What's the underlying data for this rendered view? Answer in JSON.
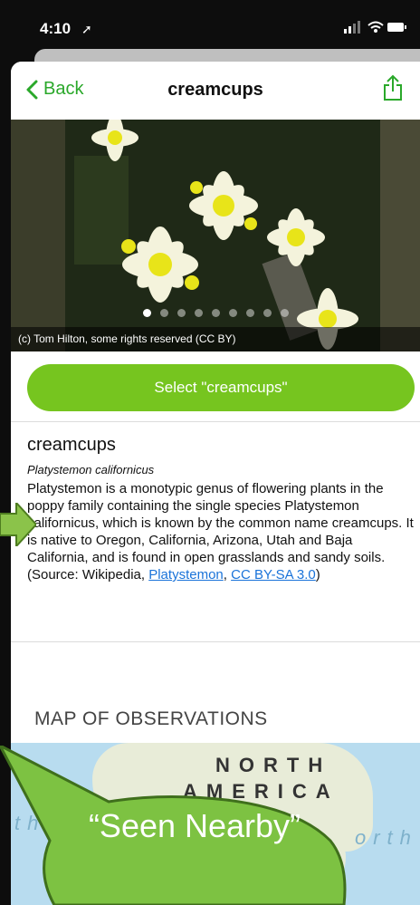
{
  "status_bar": {
    "time": "4:10"
  },
  "nav": {
    "back_label": "Back",
    "title": "creamcups"
  },
  "photo": {
    "credit": "(c) Tom Hilton, some rights reserved (CC BY)",
    "dot_count": 9,
    "active_dot": 0
  },
  "select_button": {
    "label": "Select \"creamcups\""
  },
  "species": {
    "common_name": "creamcups",
    "scientific_name": "Platystemon californicus",
    "description": "Platystemon is a monotypic genus of flowering plants in the poppy family containing the single species Platystemon californicus, which is known by the common name creamcups. It is native to Oregon, California, Arizona, Utah and Baja California, and is found in open grasslands and sandy soils. (Source: Wikipedia, ",
    "link1": "Platystemon",
    "sep": ", ",
    "link2": "CC BY-SA 3.0",
    "close": ")"
  },
  "map": {
    "section_title": "MAP OF OBSERVATIONS",
    "label_line1": "NORTH",
    "label_line2": "AMERICA",
    "ocean_left": "th",
    "ocean_right": "orth"
  },
  "callout": {
    "text": "“Seen Nearby”"
  },
  "colors": {
    "accent_green": "#76c51f",
    "back_green": "#2aa82a",
    "link_blue": "#1a73d9",
    "callout_green": "#7dc242"
  }
}
